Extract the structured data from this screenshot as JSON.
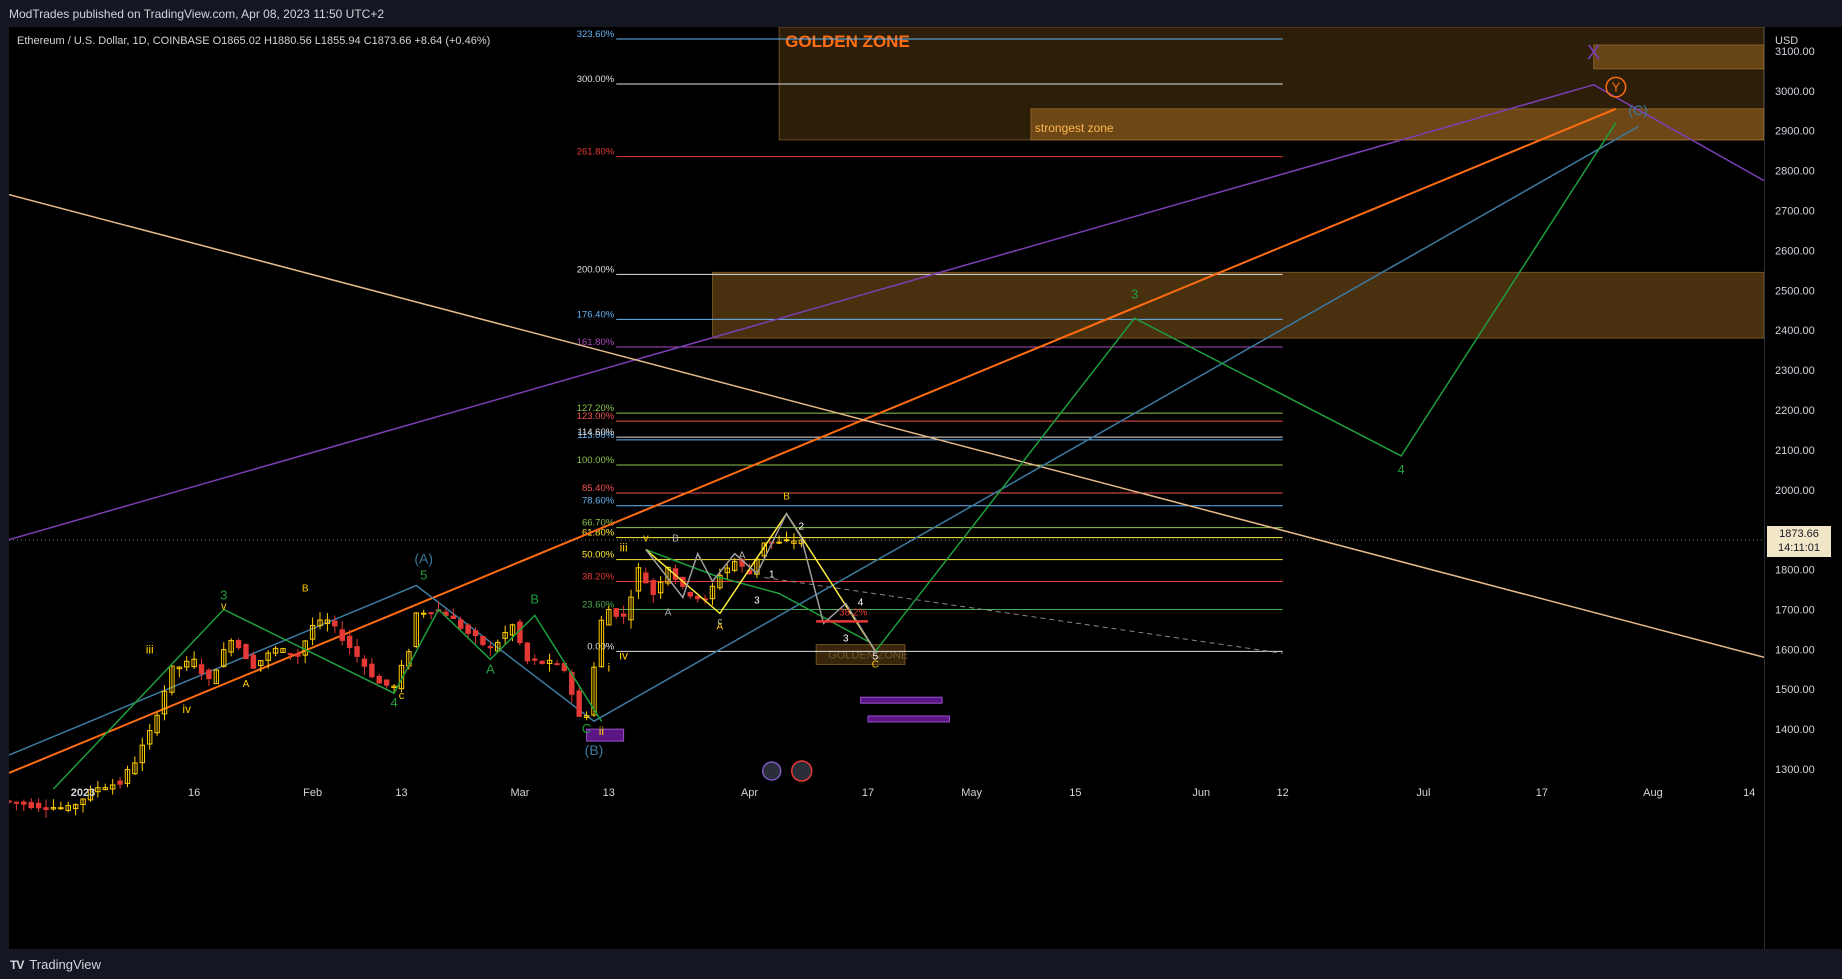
{
  "header": {
    "published": "ModTrades published on TradingView.com, Apr 08, 2023 11:50 UTC+2"
  },
  "legend": {
    "text": "Ethereum / U.S. Dollar, 1D, COINBASE  O1865.02  H1880.56  L1855.94  C1873.66  +8.64 (+0.46%)"
  },
  "footer": {
    "brand": "TradingView",
    "brand_icon": "tradingview-logo-icon"
  },
  "colors": {
    "background": "#000000",
    "candle_up": "#ffcc00",
    "candle_down": "#e53935",
    "fib_blue": "#64b5f6",
    "zone_fill": "#a26a1f",
    "orange_trend": "#ff6d12",
    "purple_trend": "#7b3fb5",
    "tan_trend": "#e6b98a",
    "teal_trend": "#3d7aa0",
    "green_wave": "#1f9e3e",
    "yellow_wave": "#ffeb3b"
  },
  "chart_data": {
    "type": "candlestick",
    "symbol": "Ethereum / U.S. Dollar",
    "interval": "1D",
    "exchange": "COINBASE",
    "ohlc": {
      "open": 1865.02,
      "high": 1880.56,
      "low": 1855.94,
      "close": 1873.66,
      "change": "+8.64 (+0.46%)"
    },
    "currency": "USD",
    "last_price": "1873.66",
    "countdown": "14:11:01",
    "ylim": [
      1270,
      3160
    ],
    "y_ticks": [
      1300,
      1400,
      1500,
      1600,
      1700,
      1800,
      1900,
      2000,
      2100,
      2200,
      2300,
      2400,
      2500,
      2600,
      2700,
      2800,
      2900,
      3000,
      3100
    ],
    "x_start": "2022-12-22",
    "x_end": "2023-08-16",
    "x_ticks": [
      {
        "date": "2023-01-01",
        "label": "2023",
        "bold": true
      },
      {
        "date": "2023-01-16",
        "label": "16"
      },
      {
        "date": "2023-02-01",
        "label": "Feb"
      },
      {
        "date": "2023-02-13",
        "label": "13"
      },
      {
        "date": "2023-03-01",
        "label": "Mar"
      },
      {
        "date": "2023-03-13",
        "label": "13"
      },
      {
        "date": "2023-04-01",
        "label": "Apr"
      },
      {
        "date": "2023-04-17",
        "label": "17"
      },
      {
        "date": "2023-05-01",
        "label": "May"
      },
      {
        "date": "2023-05-15",
        "label": "15"
      },
      {
        "date": "2023-06-01",
        "label": "Jun"
      },
      {
        "date": "2023-06-12",
        "label": "12"
      },
      {
        "date": "2023-07-01",
        "label": "Jul"
      },
      {
        "date": "2023-07-17",
        "label": "17"
      },
      {
        "date": "2023-08-01",
        "label": "Aug"
      },
      {
        "date": "2023-08-14",
        "label": "14"
      }
    ],
    "price_path": [
      [
        "2022-12-22",
        1220
      ],
      [
        "2022-12-31",
        1200
      ],
      [
        "2023-01-04",
        1255
      ],
      [
        "2023-01-07",
        1265
      ],
      [
        "2023-01-09",
        1320
      ],
      [
        "2023-01-11",
        1390
      ],
      [
        "2023-01-14",
        1550
      ],
      [
        "2023-01-17",
        1570
      ],
      [
        "2023-01-19",
        1520
      ],
      [
        "2023-01-22",
        1630
      ],
      [
        "2023-01-25",
        1560
      ],
      [
        "2023-01-28",
        1600
      ],
      [
        "2023-01-31",
        1585
      ],
      [
        "2023-02-02",
        1660
      ],
      [
        "2023-02-04",
        1670
      ],
      [
        "2023-02-06",
        1630
      ],
      [
        "2023-02-09",
        1560
      ],
      [
        "2023-02-11",
        1515
      ],
      [
        "2023-02-13",
        1505
      ],
      [
        "2023-02-15",
        1600
      ],
      [
        "2023-02-16",
        1690
      ],
      [
        "2023-02-18",
        1700
      ],
      [
        "2023-02-20",
        1690
      ],
      [
        "2023-02-23",
        1640
      ],
      [
        "2023-02-26",
        1600
      ],
      [
        "2023-03-01",
        1660
      ],
      [
        "2023-03-03",
        1570
      ],
      [
        "2023-03-06",
        1565
      ],
      [
        "2023-03-08",
        1550
      ],
      [
        "2023-03-10",
        1430
      ],
      [
        "2023-03-11",
        1440
      ],
      [
        "2023-03-13",
        1670
      ],
      [
        "2023-03-14",
        1700
      ],
      [
        "2023-03-16",
        1680
      ],
      [
        "2023-03-18",
        1800
      ],
      [
        "2023-03-20",
        1740
      ],
      [
        "2023-03-22",
        1810
      ],
      [
        "2023-03-24",
        1750
      ],
      [
        "2023-03-27",
        1720
      ],
      [
        "2023-03-29",
        1790
      ],
      [
        "2023-03-31",
        1820
      ],
      [
        "2023-04-02",
        1790
      ],
      [
        "2023-04-04",
        1870
      ],
      [
        "2023-04-06",
        1865
      ],
      [
        "2023-04-08",
        1873.66
      ]
    ],
    "fib_levels": [
      {
        "label": "0.00%",
        "value": 1595,
        "color": "#e0e0e0"
      },
      {
        "label": "23.60%",
        "value": 1700,
        "color": "#4caf50"
      },
      {
        "label": "38.20%",
        "value": 1770,
        "color": "#e53935"
      },
      {
        "label": "50.00%",
        "value": 1825,
        "color": "#ffeb3b"
      },
      {
        "label": "61.80%",
        "value": 1880,
        "color": "#ffeb3b"
      },
      {
        "label": "66.70%",
        "value": 1905,
        "color": "#8bc34a"
      },
      {
        "label": "78.60%",
        "value": 1960,
        "color": "#64b5f6"
      },
      {
        "label": "85.40%",
        "value": 1992,
        "color": "#ef5350"
      },
      {
        "label": "100.00%",
        "value": 2062,
        "color": "#8bc34a"
      },
      {
        "label": "113.00%",
        "value": 2125,
        "color": "#64b5f6"
      },
      {
        "label": "114.60%",
        "value": 2132,
        "color": "#e0e0e0"
      },
      {
        "label": "123.00%",
        "value": 2172,
        "color": "#ef5350"
      },
      {
        "label": "127.20%",
        "value": 2192,
        "color": "#8bc34a"
      },
      {
        "label": "161.80%",
        "value": 2358,
        "color": "#ab47bc"
      },
      {
        "label": "176.40%",
        "value": 2427,
        "color": "#64b5f6"
      },
      {
        "label": "200.00%",
        "value": 2540,
        "color": "#e0e0e0"
      },
      {
        "label": "261.80%",
        "value": 2835,
        "color": "#e53935"
      },
      {
        "label": "300.00%",
        "value": 3017,
        "color": "#e0e0e0"
      },
      {
        "label": "323.60%",
        "value": 3130,
        "color": "#64b5f6"
      }
    ],
    "zones": [
      {
        "label": "GOLDEN ZONE",
        "x0": "2023-04-05",
        "x1": "2023-08-16",
        "y0": 2877,
        "y1": 3160,
        "opacity": 0.28
      },
      {
        "label": "strongest zone",
        "x0": "2023-05-09",
        "x1": "2023-08-16",
        "y0": 2877,
        "y1": 2955,
        "opacity": 0.55
      },
      {
        "label": "",
        "x0": "2023-07-24",
        "x1": "2023-08-16",
        "y0": 3055,
        "y1": 3115,
        "opacity": 0.5
      },
      {
        "label": "",
        "x0": "2023-03-27",
        "x1": "2023-08-16",
        "y0": 2380,
        "y1": 2545,
        "opacity": 0.45
      },
      {
        "label": "GOLDEN ZONE",
        "x0": "2023-04-10",
        "x1": "2023-04-22",
        "y0": 1562,
        "y1": 1612,
        "opacity": 0.35
      }
    ],
    "trend_lines": [
      {
        "name": "orange",
        "points": [
          [
            "2022-12-22",
            1290
          ],
          [
            "2023-07-27",
            2955
          ]
        ],
        "color": "#ff6d12",
        "width": 2
      },
      {
        "name": "purple",
        "points": [
          [
            "2022-12-22",
            1875
          ],
          [
            "2023-07-24",
            3015
          ],
          [
            "2023-08-16",
            2775
          ]
        ],
        "color": "#7b3fb5",
        "width": 1.5
      },
      {
        "name": "tan",
        "points": [
          [
            "2022-12-22",
            2740
          ],
          [
            "2023-08-16",
            1580
          ]
        ],
        "color": "#e6b98a",
        "width": 1.5
      },
      {
        "name": "teal",
        "points": [
          [
            "2022-12-22",
            1335
          ],
          [
            "2023-02-15",
            1760
          ],
          [
            "2023-03-11",
            1420
          ],
          [
            "2023-07-30",
            2910
          ]
        ],
        "color": "#3d7aa0",
        "width": 1.5
      }
    ],
    "waves": [
      {
        "name": "green-projection",
        "color": "#1f9e3e",
        "points": [
          [
            "2023-04-18",
            1595
          ],
          [
            "2023-05-23",
            2430
          ],
          [
            "2023-06-28",
            2085
          ],
          [
            "2023-07-27",
            2920
          ]
        ]
      },
      {
        "name": "green-history",
        "color": "#1f9e3e",
        "points": [
          [
            "2022-12-28",
            1250
          ],
          [
            "2023-01-20",
            1700
          ],
          [
            "2023-02-12",
            1490
          ],
          [
            "2023-02-18",
            1700
          ],
          [
            "2023-02-25",
            1575
          ],
          [
            "2023-03-03",
            1685
          ],
          [
            "2023-03-12",
            1420
          ]
        ]
      },
      {
        "name": "green-recent",
        "color": "#1f9e3e",
        "points": [
          [
            "2023-03-18",
            1850
          ],
          [
            "2023-03-28",
            1780
          ],
          [
            "2023-04-05",
            1740
          ],
          [
            "2023-04-17",
            1620
          ]
        ]
      },
      {
        "name": "yellow-abc",
        "color": "#ffeb3b",
        "points": [
          [
            "2023-03-18",
            1850
          ],
          [
            "2023-03-28",
            1690
          ],
          [
            "2023-04-06",
            1940
          ],
          [
            "2023-04-18",
            1595
          ]
        ]
      },
      {
        "name": "white-sub",
        "color": "#9e9e9e",
        "points": [
          [
            "2023-03-18",
            1850
          ],
          [
            "2023-03-23",
            1730
          ],
          [
            "2023-03-25",
            1840
          ],
          [
            "2023-03-27",
            1770
          ],
          [
            "2023-03-30",
            1840
          ],
          [
            "2023-04-02",
            1790
          ],
          [
            "2023-04-06",
            1940
          ],
          [
            "2023-04-08",
            1880
          ],
          [
            "2023-04-11",
            1665
          ],
          [
            "2023-04-14",
            1715
          ],
          [
            "2023-04-18",
            1595
          ]
        ]
      }
    ],
    "dashed_line": {
      "points": [
        [
          "2023-04-03",
          1780
        ],
        [
          "2023-06-12",
          1590
        ]
      ],
      "color": "#888888"
    },
    "support_marker": {
      "value": 1670,
      "x0": "2023-04-10",
      "x1": "2023-04-17",
      "color": "#e53935"
    },
    "purple_blocks": [
      {
        "x0": "2023-03-10",
        "x1": "2023-03-15",
        "y0": 1370,
        "y1": 1400
      },
      {
        "x0": "2023-04-16",
        "x1": "2023-04-27",
        "y0": 1465,
        "y1": 1480
      },
      {
        "x0": "2023-04-17",
        "x1": "2023-04-28",
        "y0": 1418,
        "y1": 1433
      }
    ],
    "annotations": [
      {
        "text": "X",
        "date": "2023-07-24",
        "value": 3080,
        "color": "#7b3fb5",
        "size": 20
      },
      {
        "text": "Y",
        "date": "2023-07-27",
        "value": 2998,
        "color": "#ff6d12",
        "size": 13,
        "circle": true
      },
      {
        "text": "(C)",
        "date": "2023-07-30",
        "value": 2940,
        "color": "#3d7aa0",
        "size": 14
      },
      {
        "text": "3",
        "date": "2023-05-23",
        "value": 2480,
        "color": "#1f9e3e",
        "size": 13
      },
      {
        "text": "4",
        "date": "2023-06-28",
        "value": 2040,
        "color": "#1f9e3e",
        "size": 13
      },
      {
        "text": "(A)",
        "date": "2023-02-16",
        "value": 1815,
        "color": "#3d7aa0",
        "size": 14
      },
      {
        "text": "(B)",
        "date": "2023-03-11",
        "value": 1335,
        "color": "#3d7aa0",
        "size": 14
      },
      {
        "text": "5",
        "date": "2023-02-16",
        "value": 1775,
        "color": "#1f9e3e",
        "size": 13
      },
      {
        "text": "3",
        "date": "2023-01-20",
        "value": 1725,
        "color": "#1f9e3e",
        "size": 13
      },
      {
        "text": "4",
        "date": "2023-02-12",
        "value": 1455,
        "color": "#1f9e3e",
        "size": 13
      },
      {
        "text": "B",
        "date": "2023-03-03",
        "value": 1715,
        "color": "#1f9e3e",
        "size": 13
      },
      {
        "text": "A",
        "date": "2023-02-25",
        "value": 1540,
        "color": "#1f9e3e",
        "size": 13
      },
      {
        "text": "C",
        "date": "2023-03-10",
        "value": 1390,
        "color": "#1f9e3e",
        "size": 13
      },
      {
        "text": "v",
        "date": "2023-01-20",
        "value": 1700,
        "color": "#ffcc00",
        "size": 11
      },
      {
        "text": "iii",
        "date": "2023-01-10",
        "value": 1590,
        "color": "#ffcc00",
        "size": 12
      },
      {
        "text": "iv",
        "date": "2023-01-15",
        "value": 1440,
        "color": "#ffcc00",
        "size": 12
      },
      {
        "text": "B",
        "date": "2023-01-31",
        "value": 1745,
        "color": "#ffcc00",
        "size": 10
      },
      {
        "text": "A",
        "date": "2023-01-23",
        "value": 1505,
        "color": "#ffcc00",
        "size": 10
      },
      {
        "text": "c",
        "date": "2023-02-13",
        "value": 1475,
        "color": "#ffcc00",
        "size": 11
      },
      {
        "text": "i",
        "date": "2023-03-13",
        "value": 1545,
        "color": "#ffcc00",
        "size": 12
      },
      {
        "text": "ii",
        "date": "2023-03-12",
        "value": 1385,
        "color": "#ffcc00",
        "size": 12
      },
      {
        "text": "iii",
        "date": "2023-03-15",
        "value": 1845,
        "color": "#ffcc00",
        "size": 12
      },
      {
        "text": "iv",
        "date": "2023-03-15",
        "value": 1575,
        "color": "#ffcc00",
        "size": 12
      },
      {
        "text": "v",
        "date": "2023-03-18",
        "value": 1870,
        "color": "#ffcc00",
        "size": 11
      },
      {
        "text": "B",
        "date": "2023-04-06",
        "value": 1975,
        "color": "#ffcc00",
        "size": 10
      },
      {
        "text": "A",
        "date": "2023-03-28",
        "value": 1650,
        "color": "#ffcc00",
        "size": 10
      },
      {
        "text": "C",
        "date": "2023-04-18",
        "value": 1555,
        "color": "#ffcc00",
        "size": 10
      },
      {
        "text": "A",
        "date": "2023-03-21",
        "value": 1685,
        "color": "#b0b0b0",
        "size": 10
      },
      {
        "text": "B",
        "date": "2023-03-22",
        "value": 1870,
        "color": "#b0b0b0",
        "size": 10
      },
      {
        "text": "A",
        "date": "2023-03-31",
        "value": 1828,
        "color": "#b0b0b0",
        "size": 10
      },
      {
        "text": "c",
        "date": "2023-03-28",
        "value": 1662,
        "color": "#b0b0b0",
        "size": 10
      },
      {
        "text": "1",
        "date": "2023-04-04",
        "value": 1780,
        "color": "#ffffff",
        "size": 10
      },
      {
        "text": "2",
        "date": "2023-04-08",
        "value": 1900,
        "color": "#ffffff",
        "size": 10
      },
      {
        "text": "3",
        "date": "2023-04-14",
        "value": 1620,
        "color": "#ffffff",
        "size": 10
      },
      {
        "text": "4",
        "date": "2023-04-16",
        "value": 1710,
        "color": "#ffffff",
        "size": 10
      },
      {
        "text": "5",
        "date": "2023-04-18",
        "value": 1575,
        "color": "#ffffff",
        "size": 10
      },
      {
        "text": "3",
        "date": "2023-04-02",
        "value": 1715,
        "color": "#ffffff",
        "size": 10
      },
      {
        "text": "38.2%",
        "date": "2023-04-15",
        "value": 1685,
        "color": "#e53935",
        "size": 10
      }
    ]
  }
}
